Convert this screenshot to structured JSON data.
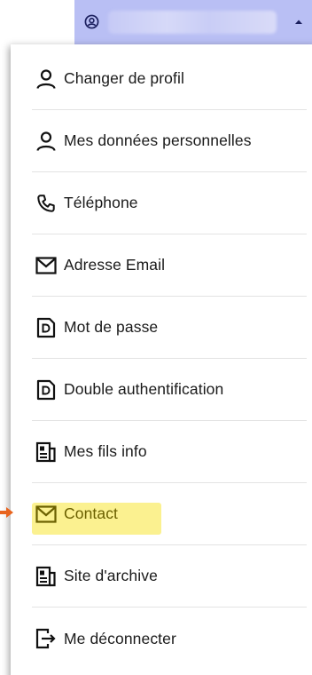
{
  "header": {
    "account_icon": "user-circle-icon",
    "caret_icon": "caret-up-icon",
    "colors": {
      "toggle_bg": "#b9bff4"
    }
  },
  "menu": {
    "items": [
      {
        "label": "Changer de profil",
        "icon": "user-icon"
      },
      {
        "label": "Mes données personnelles",
        "icon": "user-icon"
      },
      {
        "label": "Téléphone",
        "icon": "phone-icon"
      },
      {
        "label": "Adresse Email",
        "icon": "envelope-icon"
      },
      {
        "label": "Mot de passe",
        "icon": "document-lock-icon"
      },
      {
        "label": "Double authentification",
        "icon": "document-lock-icon"
      },
      {
        "label": "Mes fils info",
        "icon": "newspaper-icon"
      },
      {
        "label": "Contact",
        "icon": "envelope-icon",
        "highlighted": true
      },
      {
        "label": "Site d'archive",
        "icon": "newspaper-icon"
      },
      {
        "label": "Me déconnecter",
        "icon": "logout-icon"
      }
    ]
  },
  "annotation": {
    "arrow_icon": "arrow-right-icon",
    "colors": {
      "arrow": "#e8641e",
      "highlight": "#fbf08a"
    }
  }
}
